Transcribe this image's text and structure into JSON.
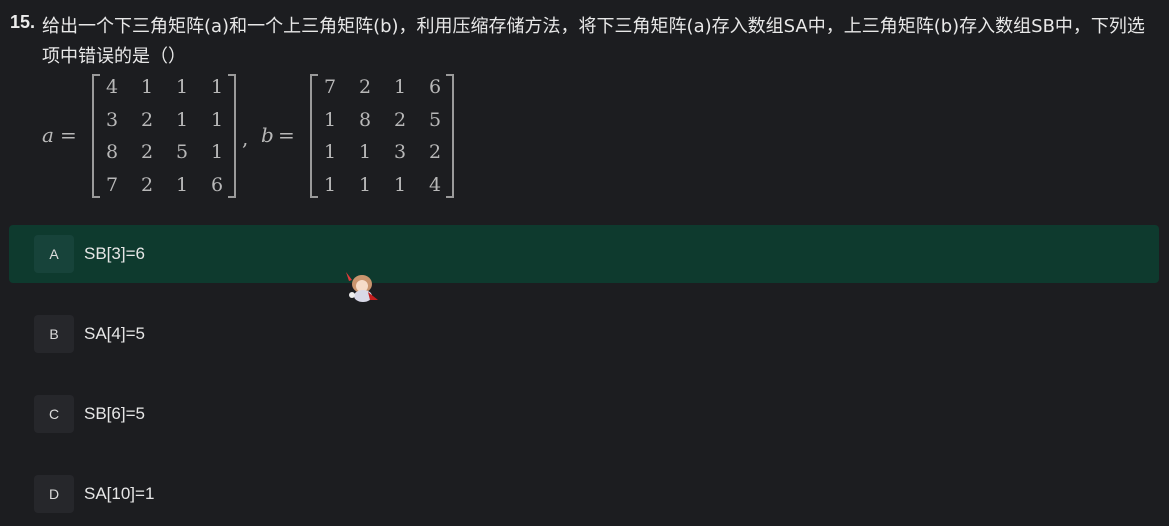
{
  "question": {
    "number": "15.",
    "text": "给出一个下三角矩阵(a)和一个上三角矩阵(b)，利用压缩存储方法，将下三角矩阵(a)存入数组SA中，上三角矩阵(b)存入数组SB中，下列选项中错误的是（）",
    "math": {
      "a_label": "a",
      "b_label": "b",
      "equals": "=",
      "comma": ",",
      "matrix_a": [
        [
          "4",
          "1",
          "1",
          "1"
        ],
        [
          "3",
          "2",
          "1",
          "1"
        ],
        [
          "8",
          "2",
          "5",
          "1"
        ],
        [
          "7",
          "2",
          "1",
          "6"
        ]
      ],
      "matrix_b": [
        [
          "7",
          "2",
          "1",
          "6"
        ],
        [
          "1",
          "8",
          "2",
          "5"
        ],
        [
          "1",
          "1",
          "3",
          "2"
        ],
        [
          "1",
          "1",
          "1",
          "4"
        ]
      ]
    }
  },
  "options": [
    {
      "letter": "A",
      "text": "SB[3]=6",
      "selected": true
    },
    {
      "letter": "B",
      "text": "SA[4]=5",
      "selected": false
    },
    {
      "letter": "C",
      "text": "SB[6]=5",
      "selected": false
    },
    {
      "letter": "D",
      "text": "SA[10]=1",
      "selected": false
    }
  ],
  "colors": {
    "background": "#1c1d20",
    "selected_option": "#0e3a2e",
    "letter_badge": "#26272b"
  },
  "decor": {
    "mascot_icon": "anime-character-sticker"
  }
}
